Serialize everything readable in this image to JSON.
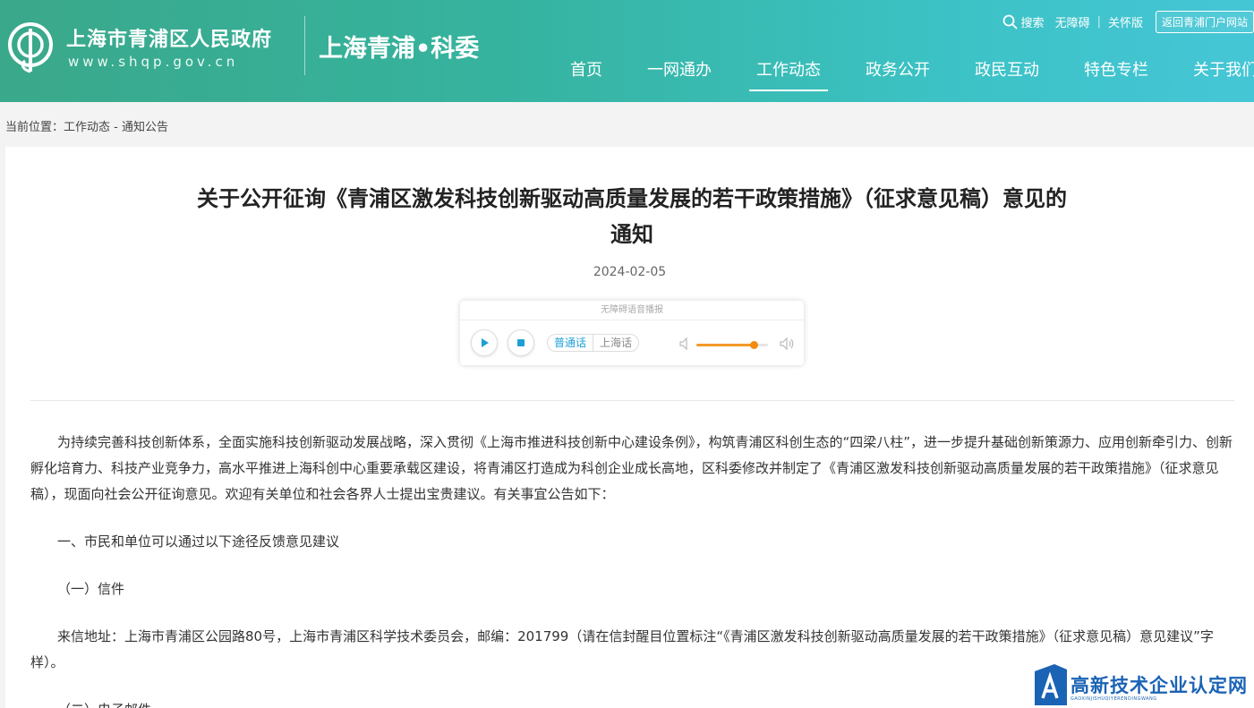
{
  "header": {
    "gov_name": "上海市青浦区人民政府",
    "gov_url": "www.shqp.gov.cn",
    "site_name": "上海青浦•科委",
    "top_links": {
      "search": "搜索",
      "accessibility": "无障碍",
      "separator": "|",
      "elder": "关怀版",
      "return_portal": "返回青浦门户网站"
    },
    "nav": [
      {
        "label": "首页"
      },
      {
        "label": "一网通办"
      },
      {
        "label": "工作动态",
        "active": true
      },
      {
        "label": "政务公开"
      },
      {
        "label": "政民互动"
      },
      {
        "label": "特色专栏"
      },
      {
        "label": "关于我们"
      }
    ],
    "colors": {
      "gradient_start": "#3aa88a",
      "gradient_end": "#45c6d6"
    }
  },
  "breadcrumb": {
    "text": "当前位置：工作动态 - 通知公告"
  },
  "article": {
    "title_line1": "关于公开征询《青浦区激发科技创新驱动高质量发展的若干政策措施》（征求意见稿）意见的",
    "title_line2": "通知",
    "date": "2024-02-05",
    "player": {
      "title": "无障碍语音播报",
      "lang_mandarin": "普通话",
      "lang_shanghai": "上海话",
      "volume_fraction": 0.8
    },
    "paragraphs": [
      "为持续完善科技创新体系，全面实施科技创新驱动发展战略，深入贯彻《上海市推进科技创新中心建设条例》，构筑青浦区科创生态的“四梁八柱”，进一步提升基础创新策源力、应用创新牵引力、创新孵化培育力、科技产业竞争力，高水平推进上海科创中心重要承载区建设，将青浦区打造成为科创企业成长高地，区科委修改并制定了《青浦区激发科技创新驱动高质量发展的若干政策措施》（征求意见稿），现面向社会公开征询意见。欢迎有关单位和社会各界人士提出宝贵建议。有关事宜公告如下：",
      "一、市民和单位可以通过以下途径反馈意见建议",
      "（一）信件",
      "来信地址：上海市青浦区公园路80号，上海市青浦区科学技术委员会，邮编：201799（请在信封醒目位置标注“《青浦区激发科技创新驱动高质量发展的若干政策措施》（征求意见稿）意见建议”字样）。",
      "（二）电子邮件"
    ]
  },
  "watermark": {
    "text": "高新技术企业认定网",
    "sub": "GAOXINJISHUQIYERENDINGWANG",
    "color": "#1b63b5"
  }
}
